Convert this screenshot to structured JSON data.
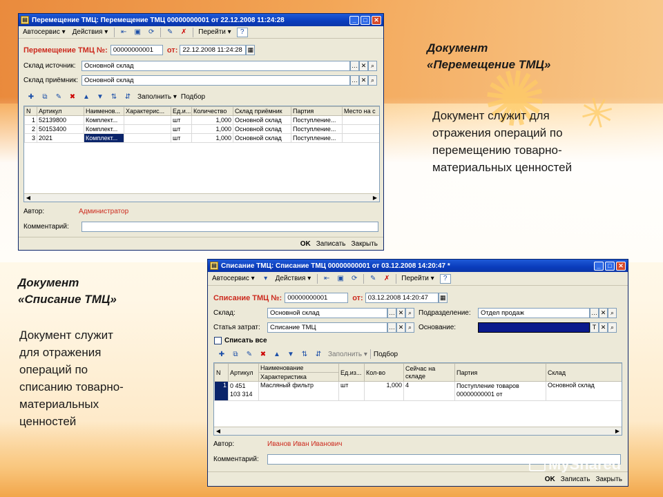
{
  "slide": {
    "move_heading_1": "Документ",
    "move_heading_2": "«Перемещение ТМЦ»",
    "move_desc": [
      "Документ служит для",
      "отражения операций по",
      "перемещению товарно-",
      "материальных ценностей"
    ],
    "writeoff_heading_1": "Документ",
    "writeoff_heading_2": "«Списание ТМЦ»",
    "writeoff_desc": [
      "Документ служит",
      "для отражения",
      "операций по",
      "списанию товарно-",
      "материальных",
      "ценностей"
    ],
    "watermark": "MyShared"
  },
  "win1": {
    "title": "Перемещение ТМЦ: Перемещение ТМЦ 00000000001 от 22.12.2008 11:24:28",
    "menu": [
      "Автосервис ▾",
      "Действия ▾",
      "Перейти ▾"
    ],
    "doc_label": "Перемещение ТМЦ №:",
    "doc_number": "00000000001",
    "date_label": "от:",
    "date_value": "22.12.2008 11:24:28",
    "source_label": "Склад источник:",
    "source_value": "Основной склад",
    "dest_label": "Склад приёмник:",
    "dest_value": "Основной склад",
    "fill_label": "Заполнить ▾",
    "select_label": "Подбор",
    "columns": [
      "N",
      "Артикул",
      "Наименов...",
      "Характерис...",
      "Ед.и...",
      "Количество",
      "Склад приёмник",
      "Партия",
      "Место на с"
    ],
    "rows": [
      [
        "1",
        "52139800",
        "Комплект...",
        "",
        "шт",
        "1,000",
        "Основной склад",
        "Поступление..."
      ],
      [
        "2",
        "50153400",
        "Комплект...",
        "",
        "шт",
        "1,000",
        "Основной склад",
        "Поступление..."
      ],
      [
        "3",
        "2021",
        "Комплект...",
        "",
        "шт",
        "1,000",
        "Основной склад",
        "Поступление..."
      ]
    ],
    "author_label": "Автор:",
    "author_value": "Администратор",
    "comment_label": "Комментарий:",
    "comment_value": "",
    "btn_ok": "OK",
    "btn_save": "Записать",
    "btn_close": "Закрыть"
  },
  "win2": {
    "title": "Списание ТМЦ: Списание ТМЦ 00000000001 от 03.12.2008 14:20:47 *",
    "menu": [
      "Автосервис ▾",
      "Действия ▾",
      "Перейти ▾"
    ],
    "doc_label": "Списание ТМЦ №:",
    "doc_number": "00000000001",
    "date_label": "от:",
    "date_value": "03.12.2008 14:20:47",
    "warehouse_label": "Склад:",
    "warehouse_value": "Основной склад",
    "division_label": "Подразделение:",
    "division_value": "Отдел продаж",
    "expense_label": "Статья затрат:",
    "expense_value": "Списание ТМЦ",
    "basis_label": "Основание:",
    "basis_value": "",
    "writeoff_all": "Списать все",
    "fill_label": "Заполнить ▾",
    "select_label": "Подбор",
    "columns": [
      "N",
      "Артикул",
      "Наименование",
      "Ед.из...",
      "Кол-во",
      "Сейчас на складе",
      "Партия",
      "Склад"
    ],
    "subcolumn": "Характеристика",
    "row": {
      "n": "1",
      "article_1": "0 451",
      "article_2": "103 314",
      "name": "Масляный фильтр",
      "unit": "шт",
      "qty": "1,000",
      "in_stock": "4",
      "batch_1": "Поступление товаров",
      "batch_2": "00000000001 от",
      "warehouse": "Основной склад"
    },
    "author_label": "Автор:",
    "author_value": "Иванов Иван Иванович",
    "comment_label": "Комментарий:",
    "comment_value": "",
    "btn_ok": "OK",
    "btn_save": "Записать",
    "btn_close": "Закрыть"
  },
  "colors": {
    "title_blue": "#0a3cbc",
    "label_red": "#cc2a1e",
    "window_bg": "#ece9d8",
    "basis_fill": "#0a1a8c"
  }
}
